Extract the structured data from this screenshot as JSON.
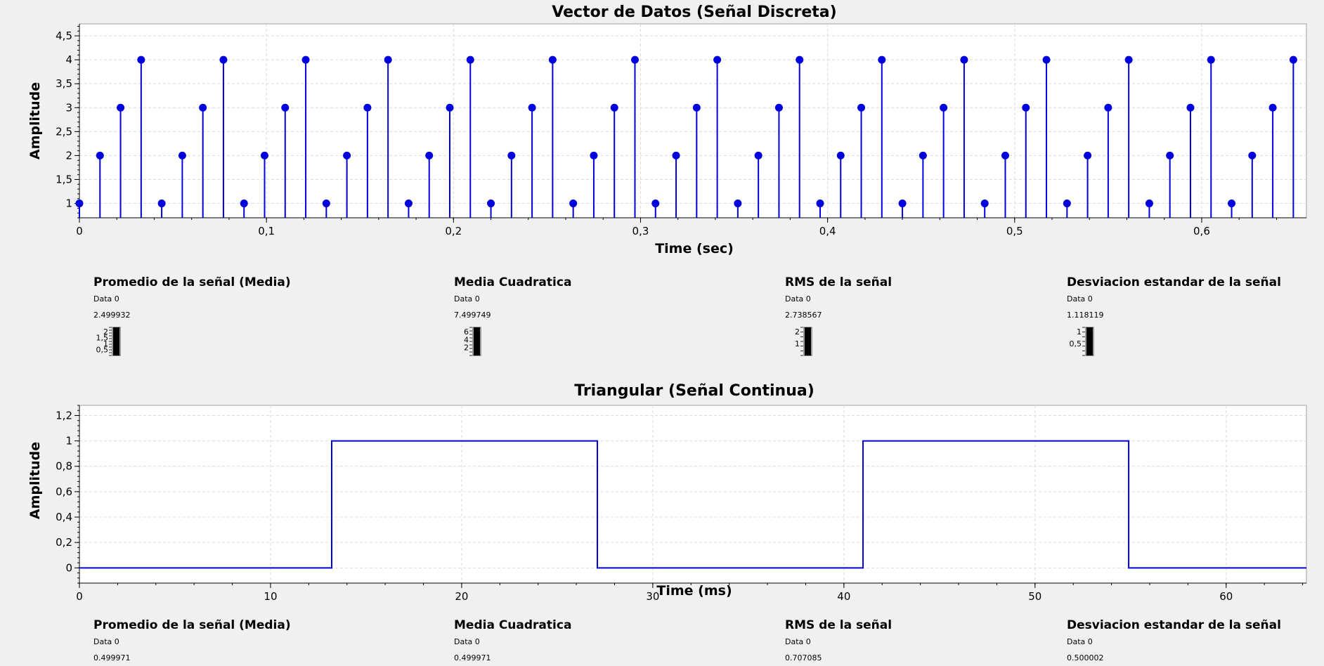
{
  "stats_top": {
    "mean": {
      "title": "Promedio de la señal (Media)",
      "series": "Data 0",
      "value": "2.499932",
      "scale": [
        "2",
        "1,5",
        "1",
        "0,5"
      ],
      "level": 2.499932,
      "scale_max": 2.5
    },
    "mean_square": {
      "title": "Media Cuadratica",
      "series": "Data 0",
      "value": "7.499749",
      "scale": [
        "6",
        "4",
        "2"
      ],
      "level": 7.499749,
      "scale_max": 7.5
    },
    "rms": {
      "title": "RMS de la señal",
      "series": "Data 0",
      "value": "2.738567",
      "scale": [
        "2",
        "1"
      ],
      "level": 2.738567,
      "scale_max": 2.75
    },
    "std": {
      "title": "Desviacion estandar de la señal",
      "series": "Data 0",
      "value": "1.118119",
      "scale": [
        "1",
        "0,5"
      ],
      "level": 1.118119,
      "scale_max": 1.12
    }
  },
  "stats_bottom": {
    "mean": {
      "title": "Promedio de la señal (Media)",
      "series": "Data 0",
      "value": "0.499971"
    },
    "mean_square": {
      "title": "Media Cuadratica",
      "series": "Data 0",
      "value": "0.499971"
    },
    "rms": {
      "title": "RMS de la señal",
      "series": "Data 0",
      "value": "0.707085"
    },
    "std": {
      "title": "Desviacion estandar de la señal",
      "series": "Data 0",
      "value": "0.500002"
    }
  },
  "colors": {
    "series": "#0000dd",
    "grid": "#dcdcdc",
    "panel": "#ffffff",
    "background": "#f0f0f0"
  },
  "chart_data": [
    {
      "type": "stem",
      "title": "Vector de Datos (Señal Discreta)",
      "xlabel": "Time (sec)",
      "ylabel": "Amplitude",
      "xlim": [
        0,
        0.656
      ],
      "ylim": [
        0.7,
        4.75
      ],
      "xticks": [
        0,
        0.1,
        0.2,
        0.3,
        0.4,
        0.5,
        0.6
      ],
      "xtick_labels": [
        "0",
        "0,1",
        "0,2",
        "0,3",
        "0,4",
        "0,5",
        "0,6"
      ],
      "yticks": [
        1,
        1.5,
        2,
        2.5,
        3,
        3.5,
        4,
        4.5
      ],
      "ytick_labels": [
        "1",
        "1,5",
        "2",
        "2,5",
        "3",
        "3,5",
        "4",
        "4,5"
      ],
      "grid": true,
      "series": [
        {
          "x": [
            0,
            0.011,
            0.022,
            0.033,
            0.044,
            0.055,
            0.066,
            0.077,
            0.088,
            0.099,
            0.11,
            0.121,
            0.132,
            0.143,
            0.154,
            0.165,
            0.176,
            0.187,
            0.198,
            0.209,
            0.22,
            0.231,
            0.242,
            0.253,
            0.264,
            0.275,
            0.286,
            0.297,
            0.308,
            0.319,
            0.33,
            0.341,
            0.352,
            0.363,
            0.374,
            0.385,
            0.396,
            0.407,
            0.418,
            0.429,
            0.44,
            0.451,
            0.462,
            0.473,
            0.484,
            0.495,
            0.506,
            0.517,
            0.528,
            0.539,
            0.55,
            0.561,
            0.572,
            0.583,
            0.594,
            0.605,
            0.616,
            0.627,
            0.638,
            0.649
          ],
          "values": [
            1,
            2,
            3,
            4,
            1,
            2,
            3,
            4,
            1,
            2,
            3,
            4,
            1,
            2,
            3,
            4,
            1,
            2,
            3,
            4,
            1,
            2,
            3,
            4,
            1,
            2,
            3,
            4,
            1,
            2,
            3,
            4,
            1,
            2,
            3,
            4,
            1,
            2,
            3,
            4,
            1,
            2,
            3,
            4,
            1,
            2,
            3,
            4,
            1,
            2,
            3,
            4,
            1,
            2,
            3,
            4,
            1,
            2,
            3,
            4
          ]
        }
      ]
    },
    {
      "type": "line",
      "title": "Triangular (Señal Continua)",
      "xlabel": "Time (ms)",
      "ylabel": "Amplitude",
      "xlim": [
        0,
        64.2
      ],
      "ylim": [
        -0.12,
        1.28
      ],
      "xticks": [
        0,
        10,
        20,
        30,
        40,
        50,
        60
      ],
      "xtick_labels": [
        "0",
        "10",
        "20",
        "30",
        "40",
        "50",
        "60"
      ],
      "yticks": [
        0,
        0.2,
        0.4,
        0.6,
        0.8,
        1,
        1.2
      ],
      "ytick_labels": [
        "0",
        "0,2",
        "0,4",
        "0,6",
        "0,8",
        "1",
        "1,2"
      ],
      "grid": true,
      "series": [
        {
          "x": [
            0,
            13.2,
            13.2,
            27.1,
            27.1,
            41.0,
            41.0,
            54.9,
            54.9,
            64.2
          ],
          "values": [
            0,
            0,
            1,
            1,
            0,
            0,
            1,
            1,
            0,
            0
          ]
        }
      ]
    }
  ]
}
